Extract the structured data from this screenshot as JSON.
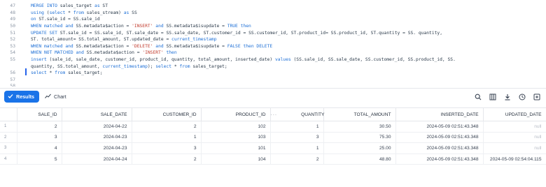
{
  "editor": {
    "lines": [
      {
        "num": "47",
        "text": "MERGE INTO sales_target as ST"
      },
      {
        "num": "48",
        "text": "using (select * from sales_stream) as SS"
      },
      {
        "num": "49",
        "text": "on ST.sale_id = SS.sale_id"
      },
      {
        "num": "50",
        "text": "WHEN matched and SS.metadata$action = 'INSERT' and SS.metadata$isupdate = TRUE then"
      },
      {
        "num": "51",
        "text": "UPDATE SET ST.sale_id = SS.sale_id, ST.sale_date = SS.sale_date, ST.customer_id = SS.customer_id, ST.product_id= SS.product_id, ST.quantity = SS. quantity,"
      },
      {
        "num": "52",
        "text": "ST. total_amount= SS.total_amount, ST.updated_date = current_timestamp"
      },
      {
        "num": "53",
        "text": "WHEN matched and SS.metadata$action = 'DELETE' and SS.metadata$isupdate = FALSE then DELETE"
      },
      {
        "num": "54",
        "text": "WHEN NOT MATCHED and SS.metadata$action = 'INSERT' then"
      },
      {
        "num": "55",
        "text": "insert (sale_id, sale_date, customer_id, product_id, quantity, total_amount, inserted_date) values (SS.sale_id, SS.sale_date, SS.customer_id, SS.product_id, SS."
      },
      {
        "num": "",
        "text": "quantity, SS.total_amount, current_timestamp); select * from sales_target;"
      },
      {
        "num": "56",
        "text": "select * from sales_target;"
      },
      {
        "num": "57",
        "text": ""
      },
      {
        "num": "58",
        "text": ""
      }
    ]
  },
  "toolbar": {
    "results_label": "Results",
    "chart_label": "Chart",
    "icons": [
      "search-icon",
      "columns-icon",
      "download-icon",
      "clock-icon",
      "expand-icon"
    ]
  },
  "grid": {
    "columns": [
      "SALE_ID",
      "SALE_DATE",
      "CUSTOMER_ID",
      "PRODUCT_ID",
      "QUANTITY",
      "TOTAL_AMOUNT",
      "INSERTED_DATE",
      "UPDATED_DATE"
    ],
    "more_glyph": "···",
    "rows": [
      {
        "idx": "1",
        "cells": [
          "2",
          "2024-04-22",
          "2",
          "102",
          "1",
          "30.50",
          "2024-05-09 02:51:43.348",
          "null"
        ]
      },
      {
        "idx": "2",
        "cells": [
          "3",
          "2024-04-23",
          "1",
          "103",
          "3",
          "75.30",
          "2024-05-09 02:51:43.348",
          "null"
        ]
      },
      {
        "idx": "3",
        "cells": [
          "4",
          "2024-04-23",
          "3",
          "101",
          "1",
          "25.00",
          "2024-05-09 02:51:43.348",
          "null"
        ]
      },
      {
        "idx": "4",
        "cells": [
          "5",
          "2024-04-24",
          "2",
          "104",
          "2",
          "48.80",
          "2024-05-09 02:51:43.348",
          "2024-05-09 02:54:04.115"
        ]
      }
    ]
  },
  "colors": {
    "accent": "#1a73e8",
    "keyword": "#1d6fd6",
    "string": "#c0392b",
    "null_text": "#b8bec7"
  }
}
